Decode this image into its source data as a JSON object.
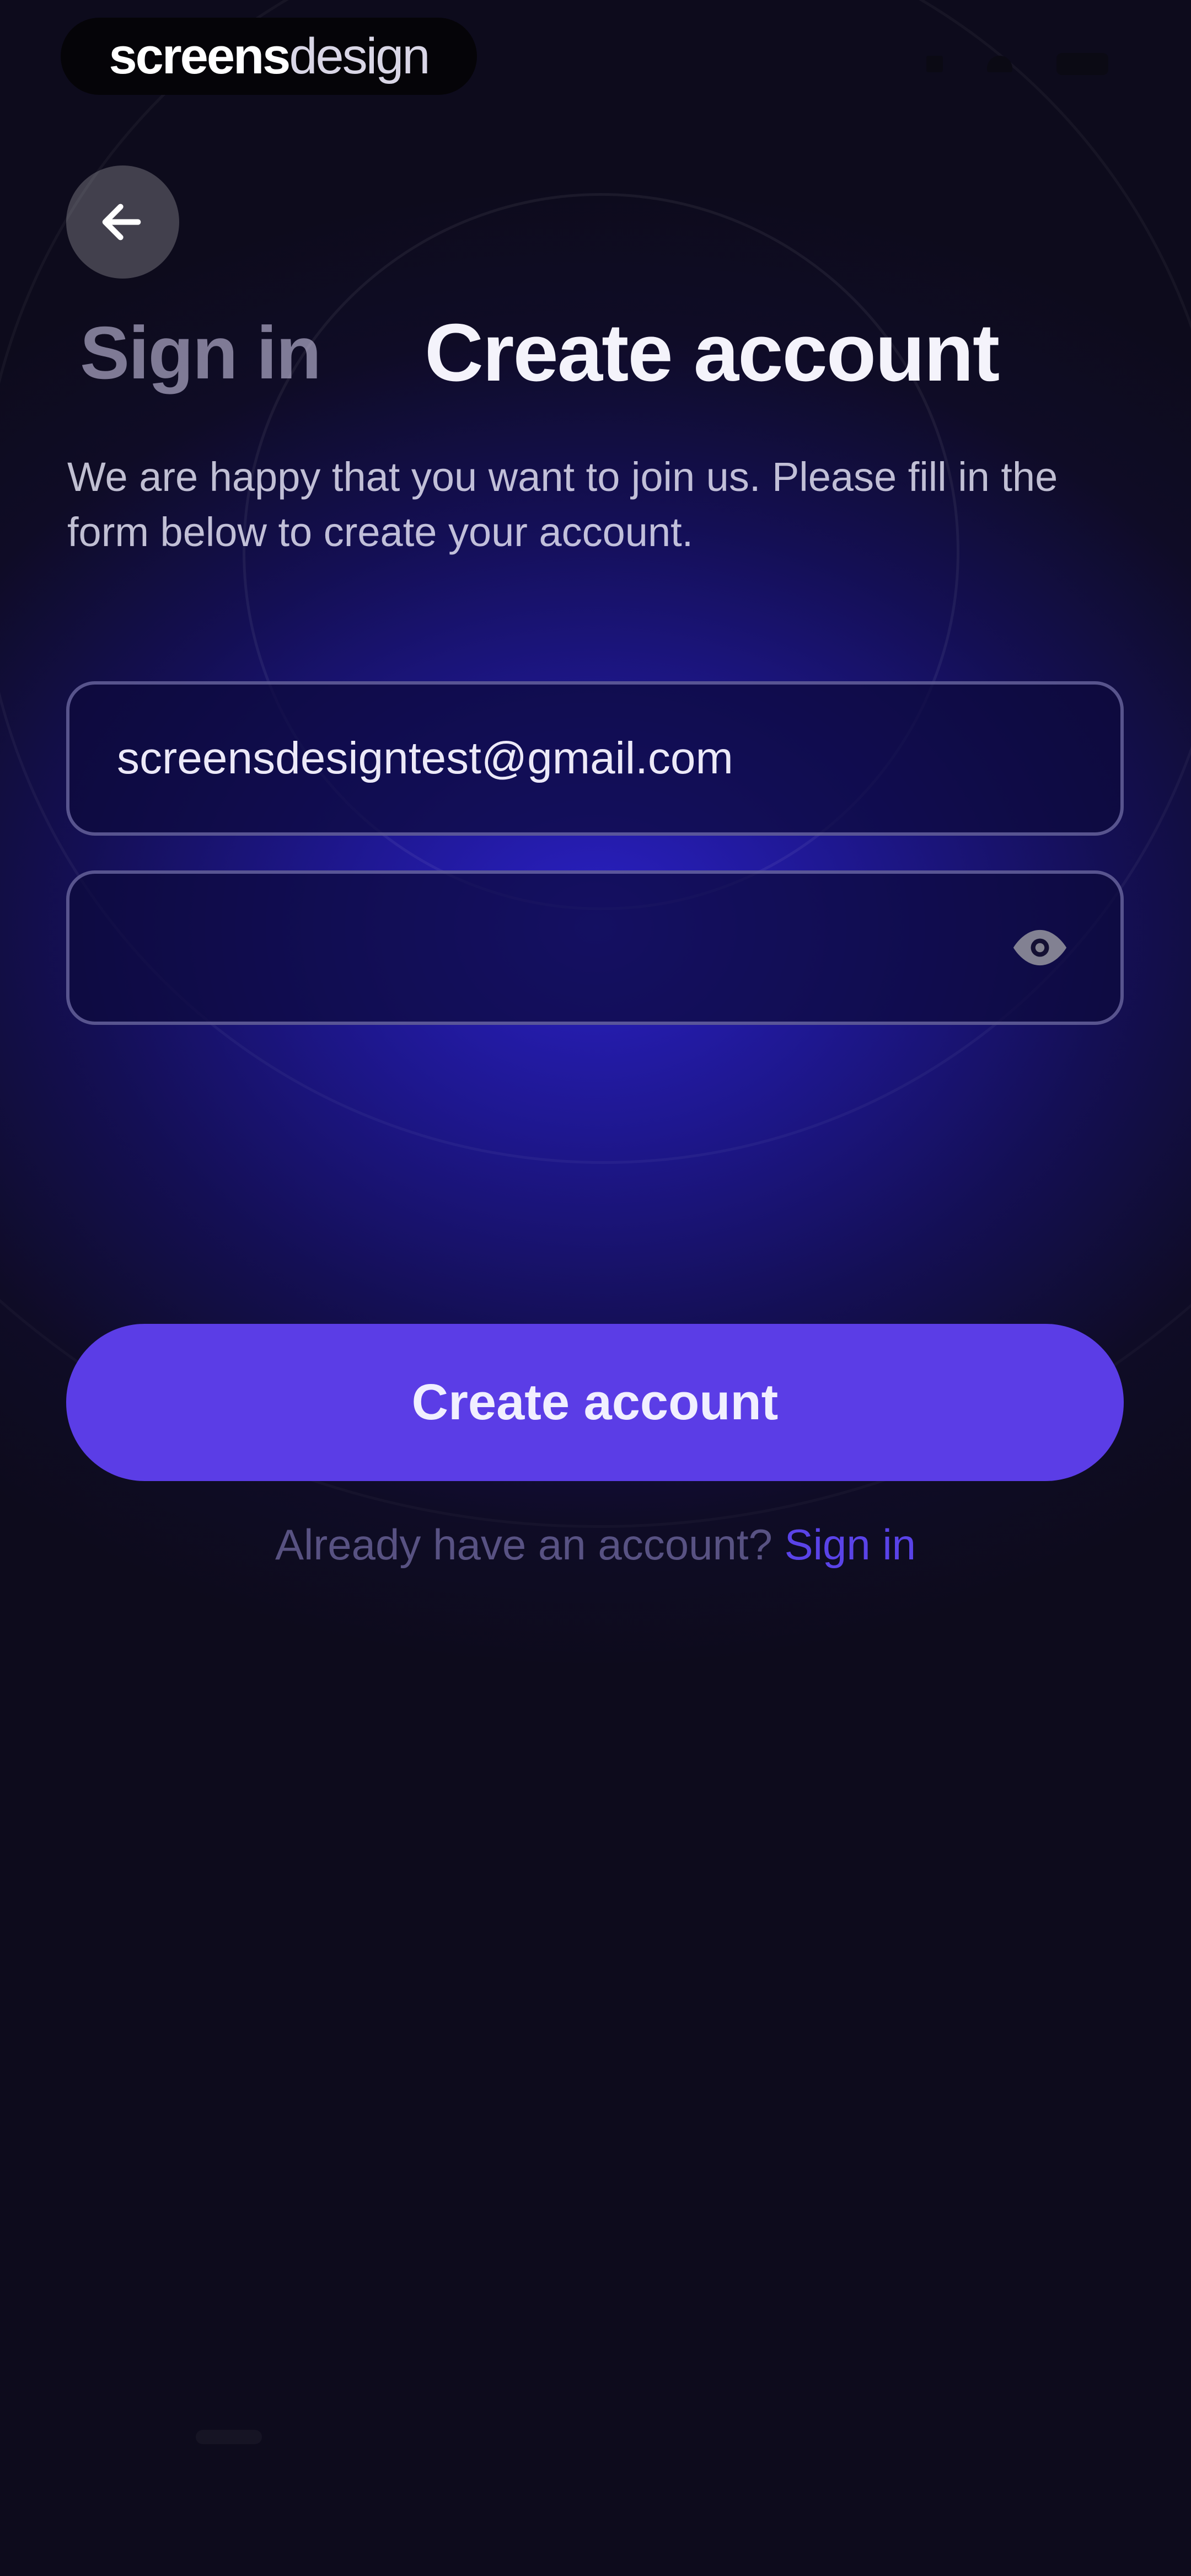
{
  "status_bar": {
    "brand_part1": "screens",
    "brand_part2": "design"
  },
  "header": {
    "back_icon": "arrow-left-icon",
    "tab_signin": "Sign in",
    "tab_create": "Create account"
  },
  "intro_text": "We are happy that you want to join us. Please fill in the form below to create your account.",
  "form": {
    "email_value": "screensdesigntest@gmail.com",
    "password_value": "",
    "password_toggle_icon": "eye-icon"
  },
  "actions": {
    "create_account_label": "Create account",
    "signin_prompt": "Already have an account?",
    "signin_link": "Sign in"
  },
  "colors": {
    "accent": "#5b3de6",
    "background_top": "#1e178f",
    "background_bottom": "#0d0b1c"
  }
}
